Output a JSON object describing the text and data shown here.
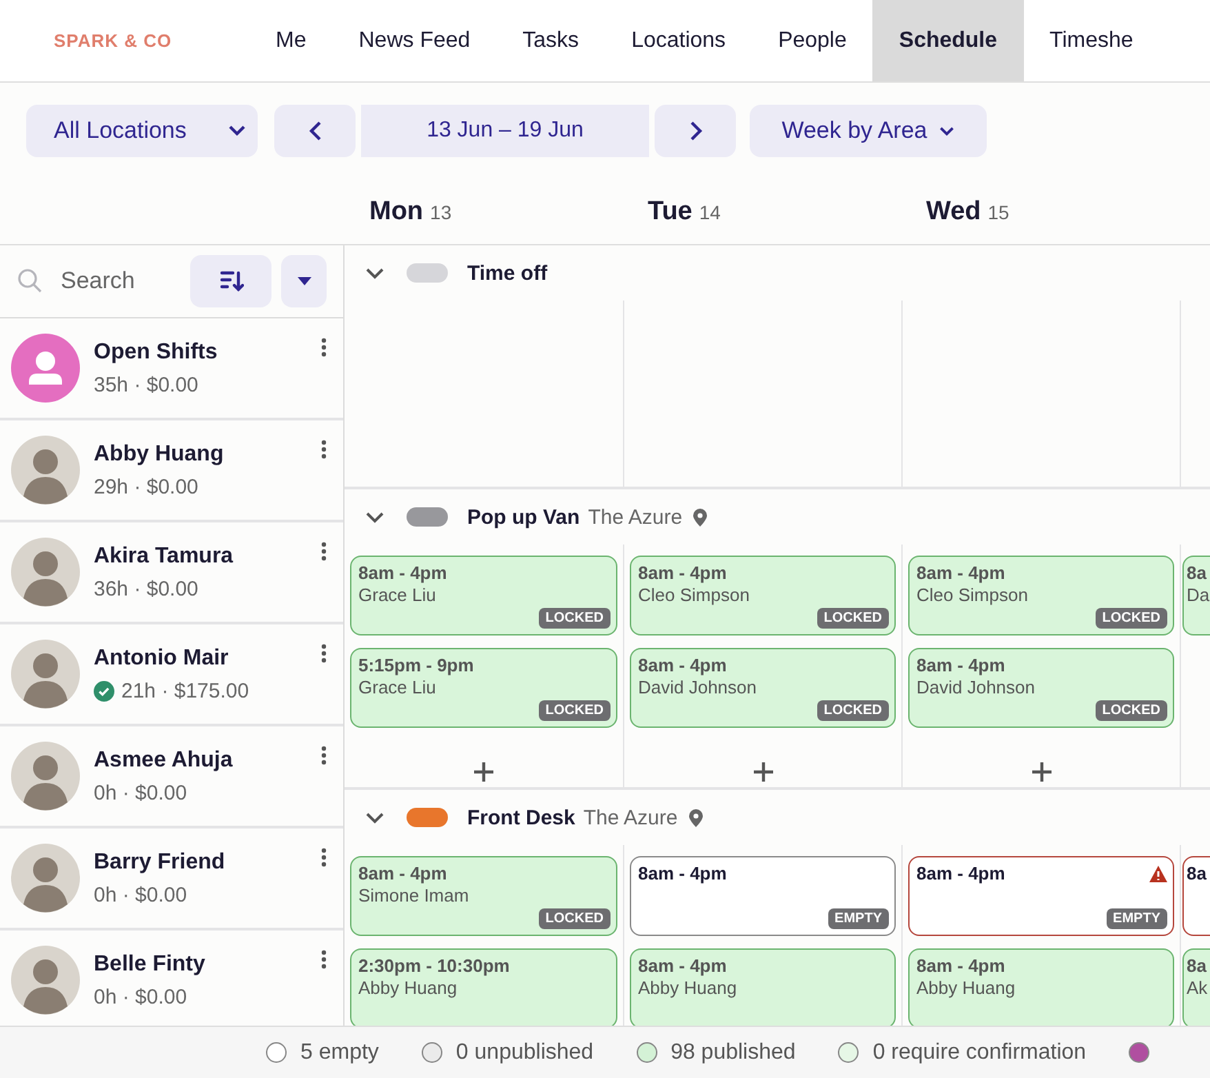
{
  "nav": {
    "brand": "SPARK & CO",
    "tabs": [
      {
        "label": "Me",
        "selected": false
      },
      {
        "label": "News Feed",
        "selected": false
      },
      {
        "label": "Tasks",
        "selected": false
      },
      {
        "label": "Locations",
        "selected": false
      },
      {
        "label": "People",
        "selected": false
      },
      {
        "label": "Schedule",
        "selected": true
      },
      {
        "label": "Timeshe",
        "selected": false
      }
    ]
  },
  "toolbar": {
    "location_filter": "All Locations",
    "date_range": "13 Jun – 19 Jun",
    "view": "Week by Area"
  },
  "days": [
    {
      "day": "Mon",
      "date": "13"
    },
    {
      "day": "Tue",
      "date": "14"
    },
    {
      "day": "Wed",
      "date": "15"
    }
  ],
  "sidebar": {
    "search": {
      "placeholder": "Search"
    },
    "people": [
      {
        "name": "Open Shifts",
        "summary": "35h · $0.00",
        "kind": "open",
        "verified": false
      },
      {
        "name": "Abby Huang",
        "summary": "29h · $0.00",
        "kind": "person",
        "verified": false
      },
      {
        "name": "Akira Tamura",
        "summary": "36h · $0.00",
        "kind": "person",
        "verified": false
      },
      {
        "name": "Antonio Mair",
        "summary": "21h · $175.00",
        "kind": "person",
        "verified": true
      },
      {
        "name": "Asmee Ahuja",
        "summary": "0h · $0.00",
        "kind": "person",
        "verified": false
      },
      {
        "name": "Barry Friend",
        "summary": "0h · $0.00",
        "kind": "person",
        "verified": false
      },
      {
        "name": "Belle Finty",
        "summary": "0h · $0.00",
        "kind": "person",
        "verified": false
      }
    ]
  },
  "areas": [
    {
      "name": "Time off",
      "color": "#d6d6da",
      "has_add": false,
      "columns": [
        [],
        [],
        [],
        []
      ]
    },
    {
      "name": "Pop up Van",
      "location": "The Azure",
      "color": "#98989c",
      "has_add": true,
      "columns": [
        [
          {
            "time": "8am - 4pm",
            "name": "Grace Liu",
            "badge": "LOCKED",
            "kind": "published"
          },
          {
            "time": "5:15pm - 9pm",
            "name": "Grace Liu",
            "badge": "LOCKED",
            "kind": "published"
          }
        ],
        [
          {
            "time": "8am - 4pm",
            "name": "Cleo Simpson",
            "badge": "LOCKED",
            "kind": "published"
          },
          {
            "time": "8am - 4pm",
            "name": "David Johnson",
            "badge": "LOCKED",
            "kind": "published"
          }
        ],
        [
          {
            "time": "8am - 4pm",
            "name": "Cleo Simpson",
            "badge": "LOCKED",
            "kind": "published"
          },
          {
            "time": "8am - 4pm",
            "name": "David Johnson",
            "badge": "LOCKED",
            "kind": "published"
          }
        ],
        [
          {
            "time": "8a",
            "name": "Da",
            "kind": "published"
          }
        ]
      ]
    },
    {
      "name": "Front Desk",
      "location": "The Azure",
      "color": "#e8762c",
      "has_add": false,
      "columns": [
        [
          {
            "time": "8am - 4pm",
            "name": "Simone Imam",
            "badge": "LOCKED",
            "kind": "published"
          },
          {
            "time": "2:30pm - 10:30pm",
            "name": "Abby Huang",
            "kind": "published"
          }
        ],
        [
          {
            "time": "8am - 4pm",
            "badge": "EMPTY",
            "kind": "empty"
          },
          {
            "time": "8am - 4pm",
            "name": "Abby Huang",
            "kind": "published"
          }
        ],
        [
          {
            "time": "8am - 4pm",
            "badge": "EMPTY",
            "kind": "warning"
          },
          {
            "time": "8am - 4pm",
            "name": "Abby Huang",
            "kind": "published"
          }
        ],
        [
          {
            "time": "8a",
            "kind": "warning"
          },
          {
            "time": "8a",
            "name": "Ak",
            "kind": "published"
          }
        ]
      ]
    }
  ],
  "status_bar": [
    {
      "label": "5 empty",
      "color": "#ffffff"
    },
    {
      "label": "0 unpublished",
      "color": "#ebebeb"
    },
    {
      "label": "98 published",
      "color": "#d4f2d6"
    },
    {
      "label": "0 require confirmation",
      "color": "#e6f7e6"
    },
    {
      "color": "#b04fa0"
    }
  ]
}
